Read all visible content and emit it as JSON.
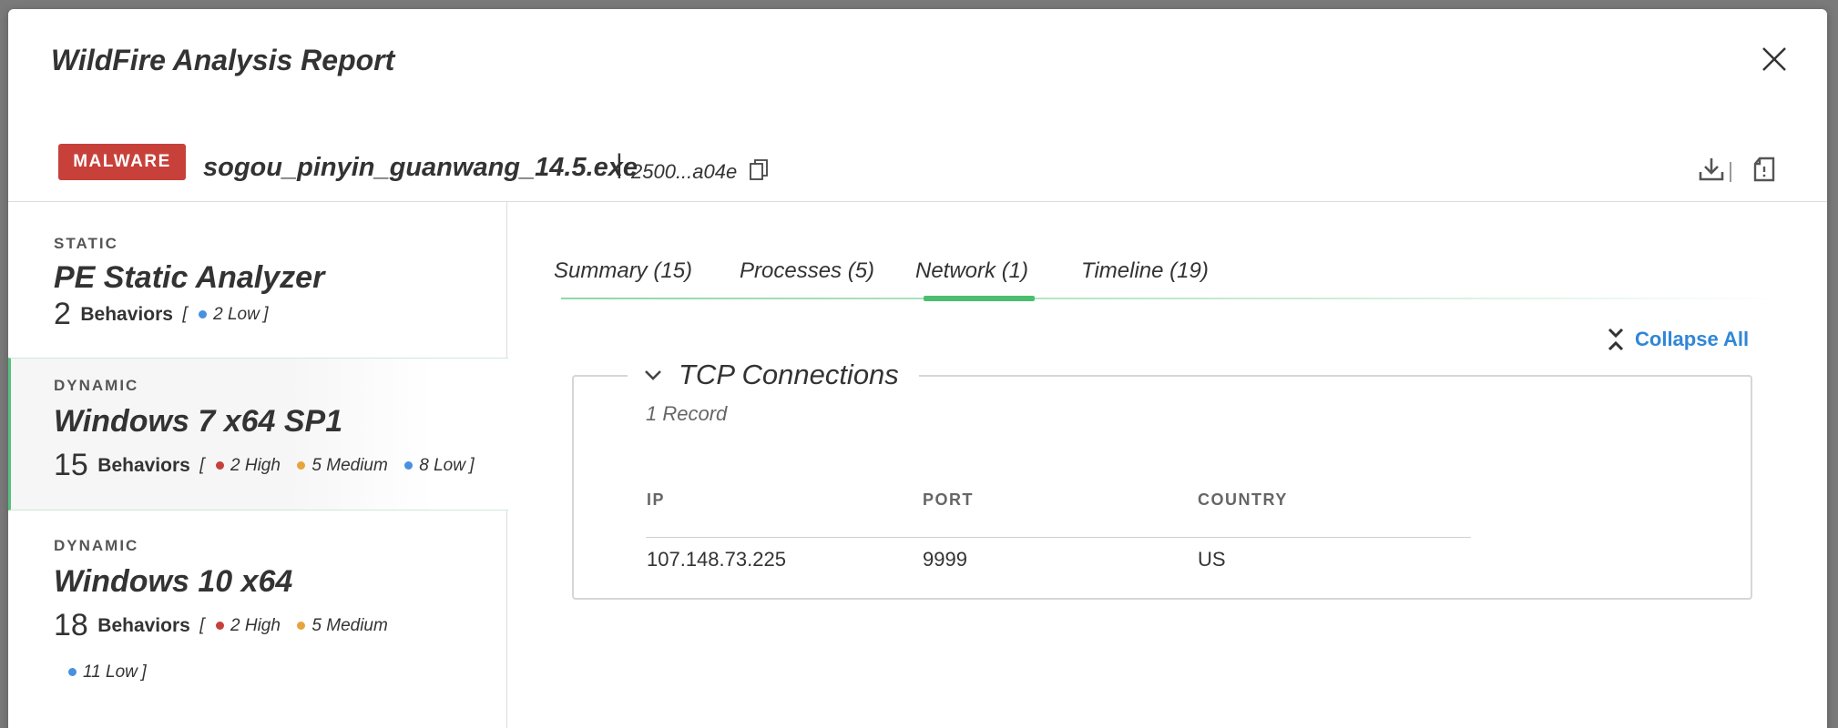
{
  "modal": {
    "title": "WildFire Analysis Report"
  },
  "file": {
    "verdict": "MALWARE",
    "name": "sogou_pinyin_guanwang_14.5.exe",
    "separator": "|",
    "hash": "2500...a04e"
  },
  "sidebar": {
    "items": [
      {
        "type": "STATIC",
        "name": "PE Static Analyzer",
        "count": "2",
        "behaviors_label": "Behaviors",
        "open": "[",
        "low": "2 Low",
        "close": "]"
      },
      {
        "type": "DYNAMIC",
        "name": "Windows 7 x64 SP1",
        "count": "15",
        "behaviors_label": "Behaviors",
        "open": "[",
        "high": "2 High",
        "medium": "5 Medium",
        "low": "8 Low",
        "close": "]",
        "active": true
      },
      {
        "type": "DYNAMIC",
        "name": "Windows 10 x64",
        "count": "18",
        "behaviors_label": "Behaviors",
        "open": "[",
        "high": "2 High",
        "medium": "5 Medium",
        "low": "11 Low",
        "close": "]"
      }
    ]
  },
  "tabs": [
    {
      "label": "Summary  (15)"
    },
    {
      "label": "Processes  (5)"
    },
    {
      "label": "Network  (1)",
      "active": true
    },
    {
      "label": "Timeline  (19)"
    }
  ],
  "collapse_all_label": "Collapse All",
  "network": {
    "section_title": "TCP Connections",
    "record_count": "1 Record",
    "columns": [
      "IP",
      "PORT",
      "COUNTRY"
    ],
    "rows": [
      {
        "ip": "107.148.73.225",
        "port": "9999",
        "country": "US"
      }
    ]
  },
  "colors": {
    "verdict": "#c7403a",
    "high": "#c7403a",
    "medium": "#e8a33d",
    "low": "#4a8fe0",
    "accent_green": "#4cbf6f",
    "link_blue": "#2f86d8"
  },
  "icons": {
    "close": "close-icon",
    "copy": "copy-icon",
    "download": "download-icon",
    "report": "report-icon",
    "chevron": "chevron-down-icon",
    "collapse": "collapse-all-icon"
  }
}
